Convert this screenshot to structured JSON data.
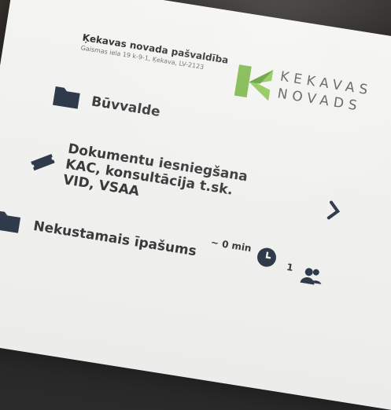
{
  "organization": {
    "name": "Ķekavas novada pašvaldība",
    "address": "Gaismas iela 19 k-9-1, Ķekava, LV-2123"
  },
  "logo": {
    "line1": "KEKAVAS",
    "line2": "NOVADS",
    "accent_color": "#7ab648"
  },
  "services": [
    {
      "label": "Būvvalde",
      "icon": "folder-icon"
    },
    {
      "label_lines": [
        "Dokumentu iesniegšana",
        "KAC, konsultācija t.sk.",
        "VID, VSAA"
      ],
      "icon": "ticket-icon"
    },
    {
      "label": "Nekustamais īpašums",
      "icon": "folder-icon"
    }
  ],
  "queue": {
    "wait_time": "~ 0 min",
    "people_count": "1"
  },
  "colors": {
    "text": "#3a3a3a",
    "icon": "#2f3a4a",
    "background": "#f2f2f0"
  }
}
